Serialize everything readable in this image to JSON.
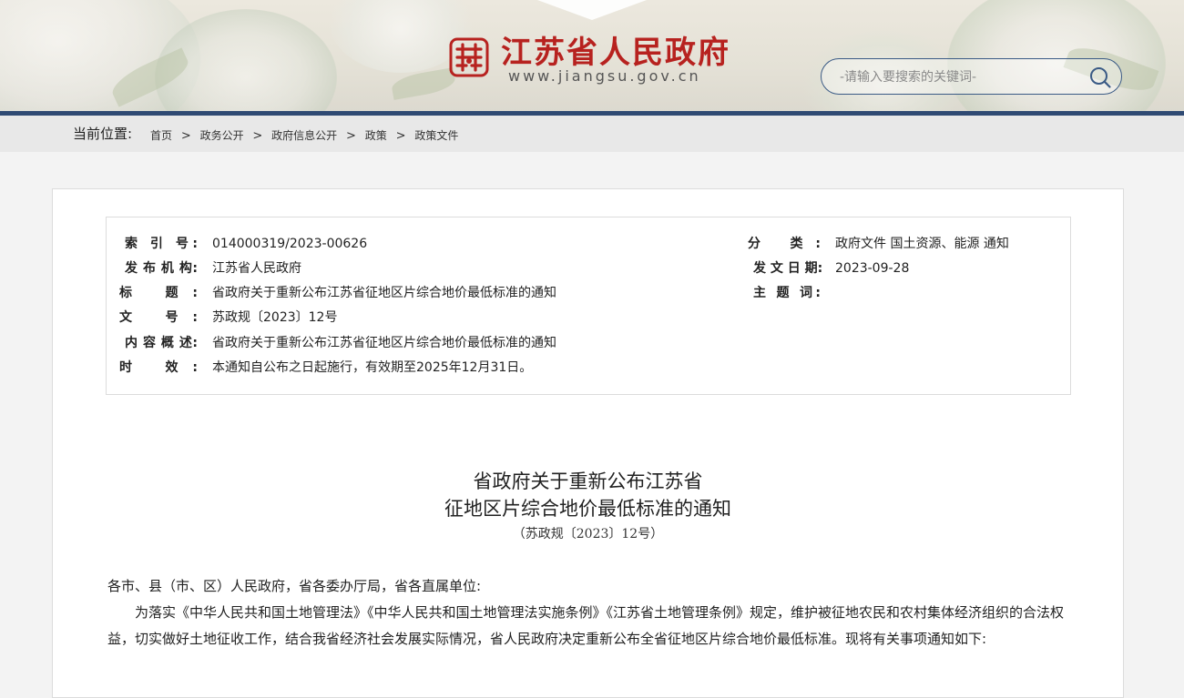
{
  "header": {
    "site_title": "江苏省人民政府",
    "site_url": "www.jiangsu.gov.cn",
    "logo_icon": "jiangsu-emblem-icon",
    "brand_color": "#b7221f",
    "accent_color": "#2f4a73",
    "search": {
      "placeholder": "-请输入要搜索的关键词-",
      "value": ""
    }
  },
  "breadcrumb": {
    "label": "当前位置:",
    "items": [
      "首页",
      "政务公开",
      "政府信息公开",
      "政策",
      "政策文件"
    ],
    "separator": ">"
  },
  "meta": {
    "index_label": "索 引 号:",
    "index_value": "014000319/2023-00626",
    "category_label": "分 类:",
    "category_value": "政府文件 国土资源、能源 通知",
    "issuer_label": "发 布 机 构:",
    "issuer_value": "江苏省人民政府",
    "date_label": "发 文 日 期:",
    "date_value": "2023-09-28",
    "title_label": "标 题:",
    "title_value": "省政府关于重新公布江苏省征地区片综合地价最低标准的通知",
    "subject_label": "主 题 词:",
    "subject_value": "",
    "docno_label": "文 号:",
    "docno_value": "苏政规〔2023〕12号",
    "summary_label": "内 容 概 述:",
    "summary_value": "省政府关于重新公布江苏省征地区片综合地价最低标准的通知",
    "validity_label": "时 效:",
    "validity_value": "本通知自公布之日起施行，有效期至2025年12月31日。"
  },
  "document": {
    "title_line1": "省政府关于重新公布江苏省",
    "title_line2": "征地区片综合地价最低标准的通知",
    "doc_number": "（苏政规〔2023〕12号）",
    "salutation": "各市、县（市、区）人民政府，省各委办厅局，省各直属单位:",
    "paragraph1": "为落实《中华人民共和国土地管理法》《中华人民共和国土地管理法实施条例》《江苏省土地管理条例》规定，维护被征地农民和农村集体经济组织的合法权益，切实做好土地征收工作，结合我省经济社会发展实际情况，省人民政府决定重新公布全省征地区片综合地价最低标准。现将有关事项通知如下:"
  }
}
